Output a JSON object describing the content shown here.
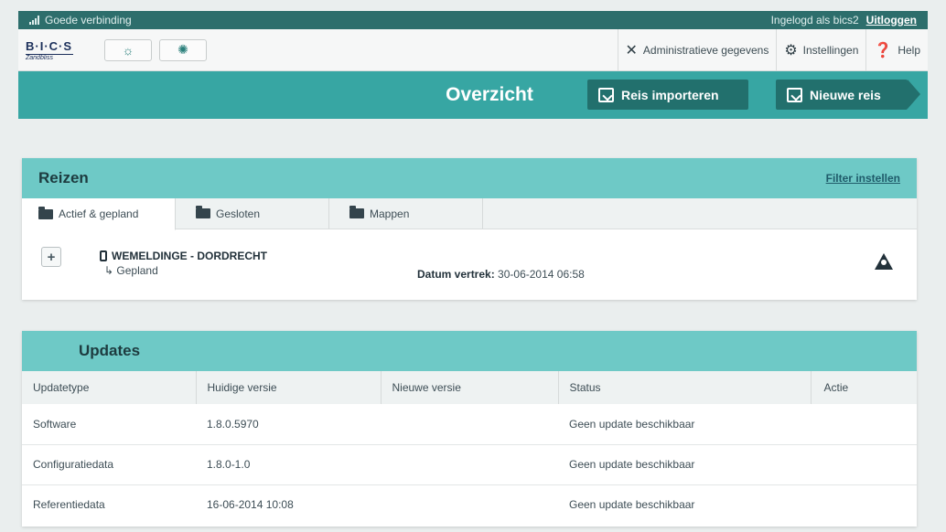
{
  "status": {
    "connection": "Goede verbinding",
    "logged_in": "Ingelogd als bics2",
    "logout": "Uitloggen"
  },
  "toolbar": {
    "logo_main": "B·I·C·S",
    "logo_sub": "Zandbliss",
    "brightness_up_icon": "sun-icon",
    "brightness_down_icon": "sun-dim-icon",
    "admin": "Administratieve gegevens",
    "settings": "Instellingen",
    "help": "Help"
  },
  "header": {
    "title": "Overzicht",
    "import_label": "Reis importeren",
    "new_label": "Nieuwe reis"
  },
  "reizen": {
    "title": "Reizen",
    "filter": "Filter instellen",
    "tabs": [
      {
        "label": "Actief & gepland"
      },
      {
        "label": "Gesloten"
      },
      {
        "label": "Mappen"
      }
    ],
    "trip": {
      "name": "WEMELDINGE - DORDRECHT",
      "status": "Gepland",
      "date_label": "Datum vertrek:",
      "date_value": "30-06-2014 06:58"
    }
  },
  "updates": {
    "title": "Updates",
    "columns": [
      "Updatetype",
      "Huidige versie",
      "Nieuwe versie",
      "Status",
      "Actie"
    ],
    "rows": [
      [
        "Software",
        "1.8.0.5970",
        "",
        "Geen update beschikbaar",
        ""
      ],
      [
        "Configuratiedata",
        "1.8.0-1.0",
        "",
        "Geen update beschikbaar",
        ""
      ],
      [
        "Referentiedata",
        "16-06-2014 10:08",
        "",
        "Geen update beschikbaar",
        ""
      ]
    ]
  },
  "colors": {
    "teal": "#37a6a3",
    "dark_teal": "#22706d",
    "panel_head": "#6ec9c6"
  }
}
